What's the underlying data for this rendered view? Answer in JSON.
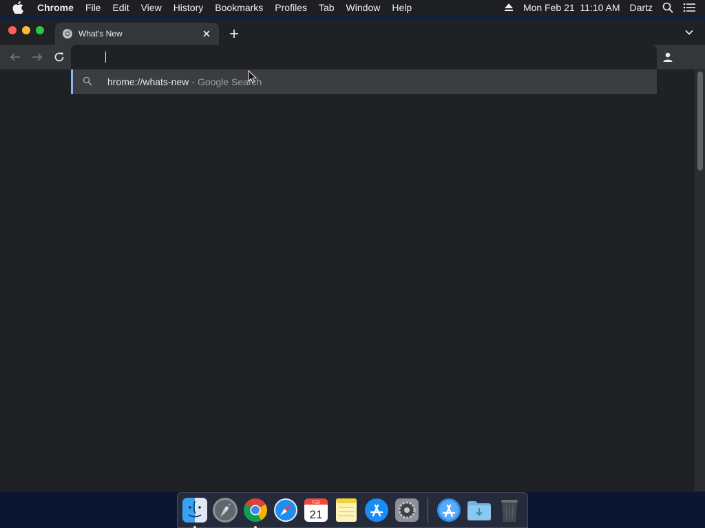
{
  "menubar": {
    "app_name": "Chrome",
    "items": [
      "File",
      "Edit",
      "View",
      "History",
      "Bookmarks",
      "Profiles",
      "Tab",
      "Window",
      "Help"
    ],
    "datetime": "Mon Feb 21  11:10 AM",
    "user": "Dartz",
    "icons": [
      "apple-icon",
      "eject-icon",
      "spotlight-search-icon",
      "control-center-list-icon"
    ]
  },
  "browser": {
    "tab": {
      "title": "What's New",
      "favicon": "chrome-icon"
    },
    "omnibox": {
      "value": "",
      "placeholder": ""
    },
    "suggestion": {
      "text": "hrome://whats-new",
      "separator": "-",
      "source": "Google Search"
    }
  },
  "dock": {
    "apps": [
      {
        "name": "Finder",
        "icon": "finder-icon",
        "running": true
      },
      {
        "name": "Launchpad",
        "icon": "launchpad-icon",
        "running": false
      },
      {
        "name": "Google Chrome",
        "icon": "chrome-icon",
        "running": true
      },
      {
        "name": "Safari",
        "icon": "safari-icon",
        "running": false
      },
      {
        "name": "Calendar",
        "icon": "calendar-icon",
        "running": false,
        "month": "FEB",
        "day": "21"
      },
      {
        "name": "Notes",
        "icon": "notes-icon",
        "running": false
      },
      {
        "name": "App Store",
        "icon": "app-store-icon",
        "running": false
      },
      {
        "name": "System Preferences",
        "icon": "system-preferences-icon",
        "running": false
      },
      {
        "name": "Applications",
        "icon": "applications-folder-icon",
        "running": false
      },
      {
        "name": "Downloads",
        "icon": "downloads-folder-icon",
        "running": false
      },
      {
        "name": "Trash",
        "icon": "trash-icon",
        "running": false
      }
    ]
  },
  "colors": {
    "accent": "#8ab4f8",
    "window_bg": "#202124",
    "toolbar_bg": "#35363a"
  }
}
